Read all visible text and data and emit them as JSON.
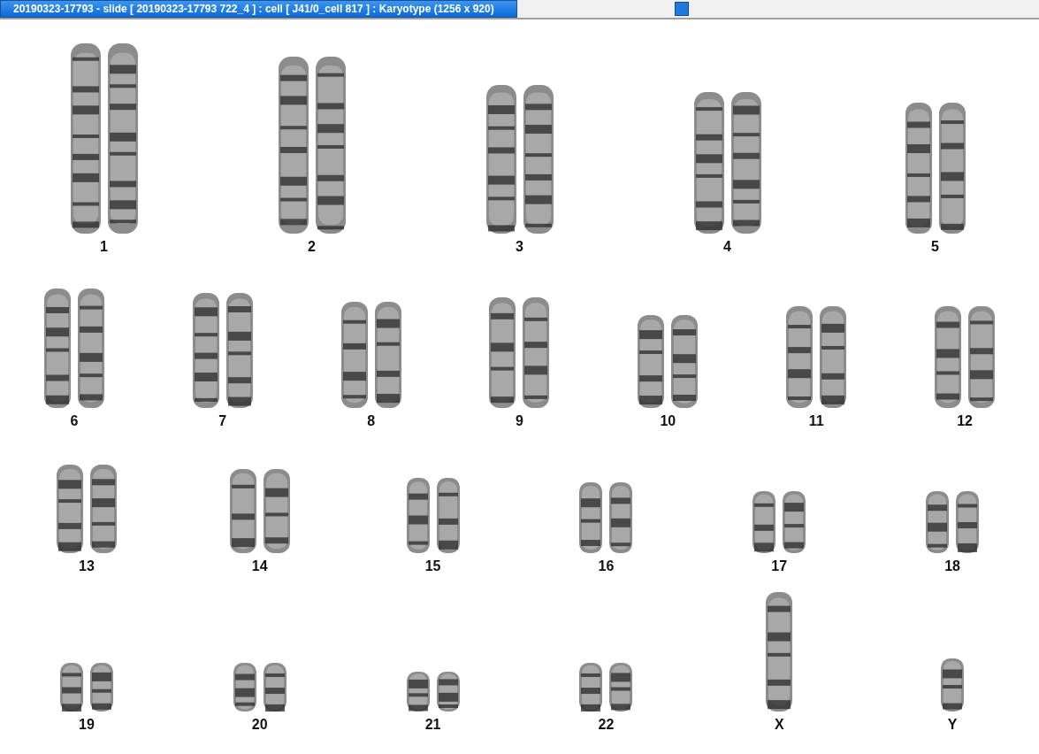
{
  "window": {
    "title": "20190323-17793 - slide [ 20190323-17793 722_4 ] : cell [ J41/0_cell 817 ] : Karyotype  (1256 x 920)",
    "selected": true
  },
  "karyotype": {
    "rows": [
      {
        "pairs": [
          {
            "label": "1",
            "kind": "pair"
          },
          {
            "label": "2",
            "kind": "pair"
          },
          {
            "label": "3",
            "kind": "pair"
          },
          {
            "label": "4",
            "kind": "pair"
          },
          {
            "label": "5",
            "kind": "pair"
          }
        ]
      },
      {
        "pairs": [
          {
            "label": "6",
            "kind": "pair"
          },
          {
            "label": "7",
            "kind": "pair"
          },
          {
            "label": "8",
            "kind": "pair"
          },
          {
            "label": "9",
            "kind": "pair"
          },
          {
            "label": "10",
            "kind": "pair"
          },
          {
            "label": "11",
            "kind": "pair"
          },
          {
            "label": "12",
            "kind": "pair"
          }
        ]
      },
      {
        "pairs": [
          {
            "label": "13",
            "kind": "pair"
          },
          {
            "label": "14",
            "kind": "pair"
          },
          {
            "label": "15",
            "kind": "pair"
          },
          {
            "label": "16",
            "kind": "pair"
          },
          {
            "label": "17",
            "kind": "pair"
          },
          {
            "label": "18",
            "kind": "pair"
          }
        ]
      },
      {
        "pairs": [
          {
            "label": "19",
            "kind": "pair"
          },
          {
            "label": "20",
            "kind": "pair"
          },
          {
            "label": "21",
            "kind": "pair"
          },
          {
            "label": "22",
            "kind": "pair"
          },
          {
            "label": "X",
            "kind": "single"
          },
          {
            "label": "Y",
            "kind": "single"
          }
        ]
      }
    ]
  }
}
